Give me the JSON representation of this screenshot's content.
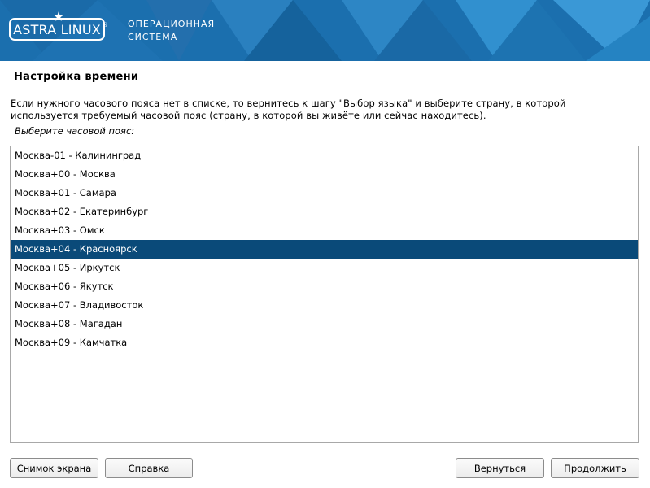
{
  "header": {
    "logo_text": "ASTRA LINUX",
    "logo_reg": "®",
    "os_line1": "ОПЕРАЦИОННАЯ",
    "os_line2": "СИСТЕМА"
  },
  "page": {
    "title": "Настройка времени",
    "description_line1": "Если нужного часового пояса нет в списке, то вернитесь к шагу \"Выбор языка\" и выберите страну, в которой",
    "description_line2": "используется требуемый часовой пояс (страну, в которой вы живёте или сейчас находитесь).",
    "prompt": "Выберите часовой пояс:"
  },
  "timezones": [
    {
      "label": "Москва-01 - Калининград",
      "selected": false
    },
    {
      "label": "Москва+00 - Москва",
      "selected": false
    },
    {
      "label": "Москва+01 - Самара",
      "selected": false
    },
    {
      "label": "Москва+02 - Екатеринбург",
      "selected": false
    },
    {
      "label": "Москва+03 - Омск",
      "selected": false
    },
    {
      "label": "Москва+04 - Красноярск",
      "selected": true
    },
    {
      "label": "Москва+05 - Иркутск",
      "selected": false
    },
    {
      "label": "Москва+06 - Якутск",
      "selected": false
    },
    {
      "label": "Москва+07 - Владивосток",
      "selected": false
    },
    {
      "label": "Москва+08 - Магадан",
      "selected": false
    },
    {
      "label": "Москва+09 - Камчатка",
      "selected": false
    }
  ],
  "buttons": {
    "screenshot": "Снимок экрана",
    "help": "Справка",
    "back": "Вернуться",
    "continue": "Продолжить"
  },
  "colors": {
    "banner": "#1b6fae",
    "selection": "#0a4a79"
  },
  "icons": {
    "logo_star": "star-icon"
  }
}
